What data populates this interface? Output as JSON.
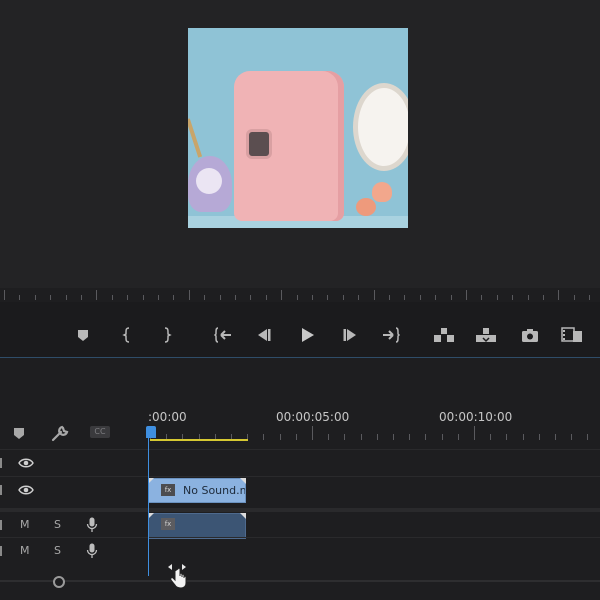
{
  "program_monitor": {
    "preview_description_icon": "preview-frame"
  },
  "transport": {
    "buttons": [
      {
        "name": "add-marker-button",
        "icon": "marker-icon",
        "glyph": "⯃"
      },
      {
        "name": "mark-in-button",
        "icon": "mark-in-icon",
        "glyph": "{"
      },
      {
        "name": "mark-out-button",
        "icon": "mark-out-icon",
        "glyph": "}"
      },
      {
        "name": "go-to-in-button",
        "icon": "go-to-in-icon",
        "glyph": "{←"
      },
      {
        "name": "step-back-button",
        "icon": "step-back-icon",
        "glyph": "◀|"
      },
      {
        "name": "play-button",
        "icon": "play-icon",
        "glyph": "▶"
      },
      {
        "name": "step-forward-button",
        "icon": "step-forward-icon",
        "glyph": "|▶"
      },
      {
        "name": "go-to-out-button",
        "icon": "go-to-out-icon",
        "glyph": "→}"
      },
      {
        "name": "lift-button",
        "icon": "lift-icon",
        "glyph": "⏏"
      },
      {
        "name": "extract-button",
        "icon": "extract-icon",
        "glyph": "⏏"
      },
      {
        "name": "export-frame-button",
        "icon": "camera-icon",
        "glyph": "📷"
      },
      {
        "name": "comparison-view-button",
        "icon": "comparison-view-icon",
        "glyph": "▦"
      }
    ]
  },
  "timeline": {
    "timecodes": [
      ":00:00",
      "00:00:05:00",
      "00:00:10:00"
    ],
    "toolbar": {
      "marker_icon": "marker-icon",
      "settings_icon": "wrench-icon",
      "captions_label": "CC"
    },
    "tracks": [
      {
        "type": "video",
        "clip": null
      },
      {
        "type": "video",
        "clip": {
          "label": "No Sound.m",
          "fx": "fx"
        }
      },
      {
        "type": "audio",
        "m": "M",
        "s": "S",
        "clip": {
          "fx": "fx"
        }
      },
      {
        "type": "audio",
        "m": "M",
        "s": "S",
        "clip": null
      }
    ]
  },
  "colors": {
    "accent_blue": "#3f8fe0",
    "work_area": "#d6c832",
    "video_clip": "#8bb2e0",
    "audio_clip": "#3c5574"
  }
}
